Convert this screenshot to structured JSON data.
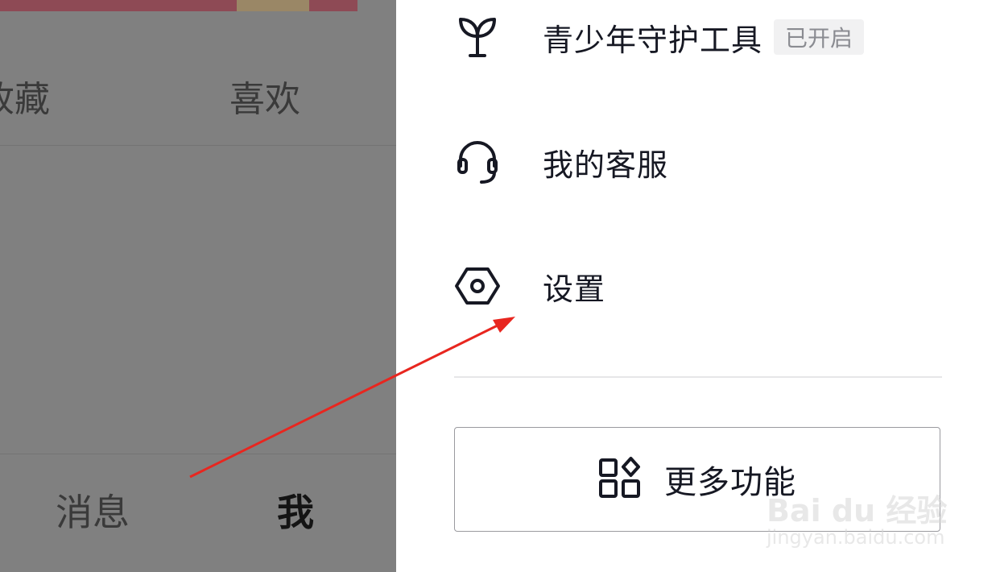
{
  "left_page": {
    "tabs": [
      "收藏",
      "喜欢"
    ],
    "bottom_nav": {
      "messages": "消息",
      "me": "我"
    }
  },
  "drawer": {
    "items": [
      {
        "label": "青少年守护工具",
        "badge": "已开启",
        "icon": "sprout-icon"
      },
      {
        "label": "我的客服",
        "icon": "headset-icon"
      },
      {
        "label": "设置",
        "icon": "hexagon-gear-icon"
      }
    ],
    "more_button": {
      "label": "更多功能",
      "icon": "apps-grid-icon"
    }
  },
  "watermark": {
    "brand": "Bai du 经验",
    "url": "jingyan.baidu.com"
  },
  "colors": {
    "overlay": "#808080",
    "text": "#161823",
    "arrow": "#e8261f"
  }
}
